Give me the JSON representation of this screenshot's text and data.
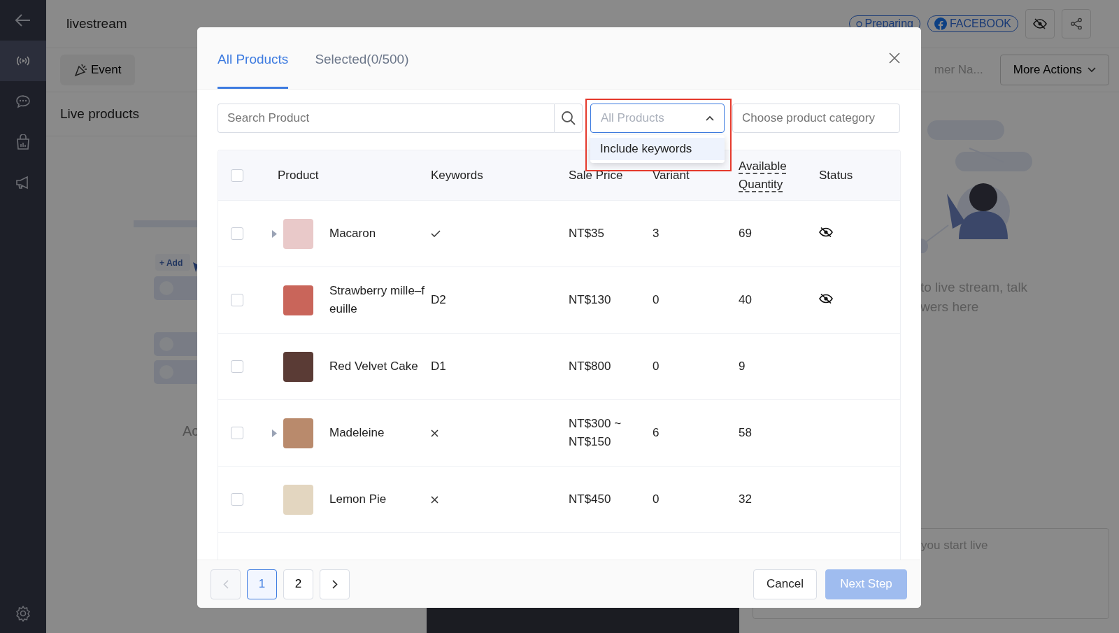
{
  "sidebar": {
    "items": [
      {
        "selected": true
      },
      {
        "selected": false
      },
      {
        "selected": false
      },
      {
        "selected": false
      }
    ]
  },
  "page": {
    "title": "livestream",
    "status_badge": "Preparing",
    "platform_badge": "FACEBOOK",
    "event_button": "Event",
    "section_title": "Live products",
    "search_partial": "mer Na...",
    "more_actions": "More Actions",
    "add_label": "+ Add",
    "empty_partial": "Ac",
    "chat_hint": [
      "to live stream, talk",
      "wers here"
    ],
    "comment_placeholder": "you start live"
  },
  "modal": {
    "tabs": [
      {
        "label": "All Products",
        "selected": true
      },
      {
        "label": "Selected(0/500)",
        "selected": false
      }
    ],
    "search": {
      "placeholder": "Search Product"
    },
    "filter": {
      "value": "All Products",
      "expanded": true,
      "highlighted": true,
      "options": [
        {
          "label": "Include keywords",
          "selected": false
        }
      ]
    },
    "category": {
      "placeholder": "Choose product category"
    },
    "table": {
      "select_all_checked": false,
      "columns": [
        "Product",
        "Keywords",
        "Sale Price",
        "Variant",
        "Available Quantity",
        "Status"
      ],
      "rows": [
        {
          "checked": false,
          "has_variants": true,
          "name": "Macaron",
          "keywords": {
            "kind": "check"
          },
          "price": "NT$35",
          "variant": "3",
          "quantity": "69",
          "hidden": true
        },
        {
          "checked": false,
          "has_variants": false,
          "name": "Strawberry mille–feuille",
          "keywords": {
            "kind": "text",
            "text": "D2"
          },
          "price": "NT$130",
          "variant": "0",
          "quantity": "40",
          "hidden": true
        },
        {
          "checked": false,
          "has_variants": false,
          "name": "Red Velvet Cake",
          "keywords": {
            "kind": "text",
            "text": "D1"
          },
          "price": "NT$800",
          "variant": "0",
          "quantity": "9",
          "hidden": false
        },
        {
          "checked": false,
          "has_variants": true,
          "name": "Madeleine",
          "keywords": {
            "kind": "cross"
          },
          "price": "NT$300 ~ NT$150",
          "variant": "6",
          "quantity": "58",
          "hidden": false
        },
        {
          "checked": false,
          "has_variants": false,
          "name": "Lemon Pie",
          "keywords": {
            "kind": "cross"
          },
          "price": "NT$450",
          "variant": "0",
          "quantity": "32",
          "hidden": false
        }
      ]
    },
    "pagination": {
      "prev_disabled": true,
      "pages": [
        {
          "label": "1",
          "selected": true
        },
        {
          "label": "2",
          "selected": false
        }
      ],
      "next_disabled": false
    },
    "buttons": [
      {
        "label": "Cancel",
        "kind": "secondary",
        "disabled": false
      },
      {
        "label": "Next Step",
        "kind": "primary",
        "disabled": true
      }
    ]
  }
}
